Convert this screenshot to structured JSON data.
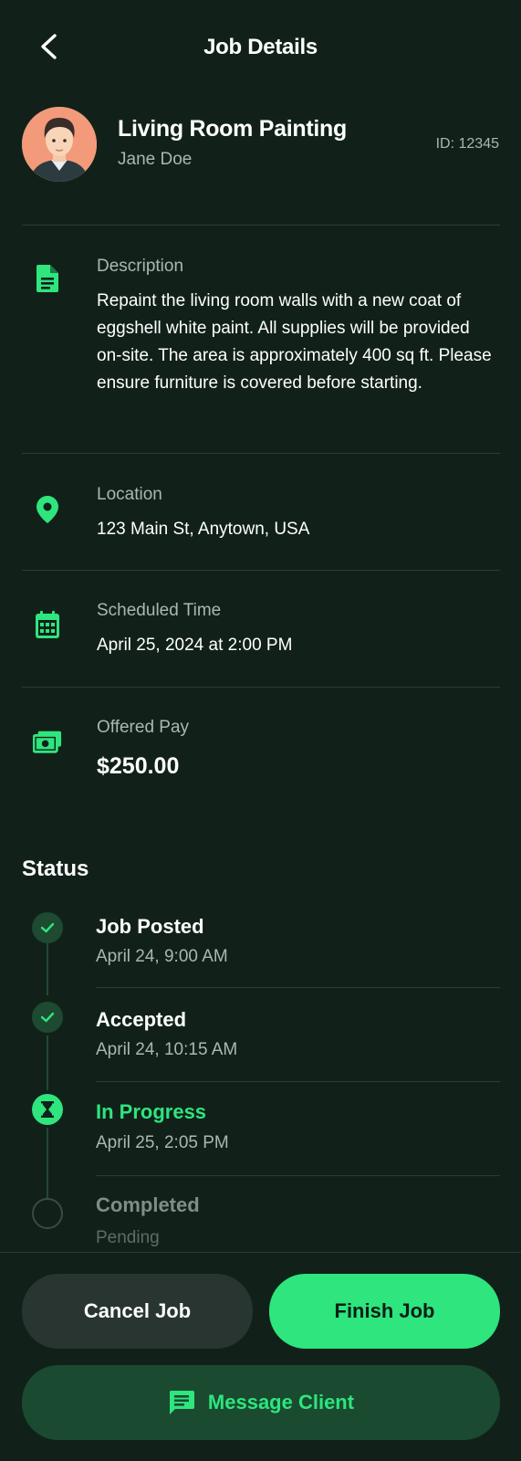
{
  "header": {
    "title": "Job Details"
  },
  "job": {
    "title": "Living Room Painting",
    "client": "Jane Doe",
    "id_label": "ID: 12345"
  },
  "details": {
    "description": {
      "label": "Description",
      "value": "Repaint the living room walls with a new coat of eggshell white paint. All supplies will be provided on-site. The area is approximately 400 sq ft. Please ensure furniture is covered before starting.",
      "icon": "document-icon"
    },
    "location": {
      "label": "Location",
      "value": "123 Main St, Anytown, USA",
      "icon": "location-pin-icon"
    },
    "scheduled": {
      "label": "Scheduled Time",
      "value": "April 25, 2024 at 2:00 PM",
      "icon": "calendar-icon"
    },
    "pay": {
      "label": "Offered Pay",
      "value": "$250.00",
      "icon": "money-icon"
    }
  },
  "status": {
    "heading": "Status",
    "steps": [
      {
        "title": "Job Posted",
        "time": "April 24, 9:00 AM",
        "state": "done"
      },
      {
        "title": "Accepted",
        "time": "April 24, 10:15 AM",
        "state": "done"
      },
      {
        "title": "In Progress",
        "time": "April 25, 2:05 PM",
        "state": "active"
      },
      {
        "title": "Completed",
        "time": "Pending",
        "state": "pending"
      }
    ]
  },
  "actions": {
    "cancel": "Cancel Job",
    "finish": "Finish Job",
    "message": "Message Client"
  },
  "colors": {
    "background": "#11211a",
    "accent": "#2ee57e",
    "muted_text": "#a9b8b0"
  }
}
